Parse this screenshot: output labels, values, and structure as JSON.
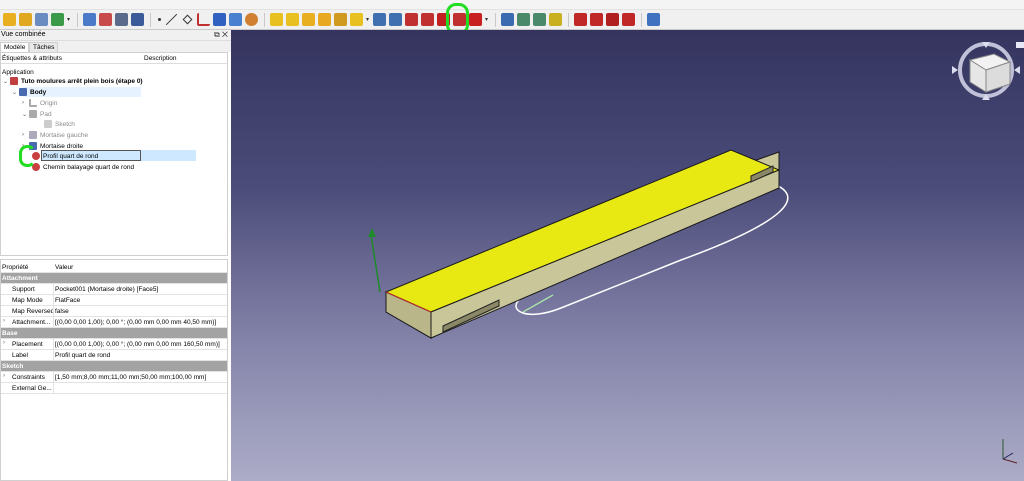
{
  "toolbar": {
    "icons": [
      "std-open-icon",
      "std-folder-icon",
      "std-save-icon",
      "std-export-icon",
      "macro-icon",
      "part-icon",
      "body-icon",
      "import-icon",
      "clone-icon",
      "point-icon",
      "line-icon",
      "plane-icon",
      "lcs-icon",
      "shapebinder-icon",
      "subshape-icon",
      "sketch-icon",
      "pad-icon",
      "revolve-icon",
      "loft-icon",
      "pipe-icon",
      "helix-icon",
      "add-box-icon",
      "pocket-icon",
      "hole-icon",
      "groove-icon",
      "subtractive-loft-icon",
      "subtractive-pipe-icon",
      "subtractive-helix-icon",
      "subtractive-box-icon",
      "mirrored-icon",
      "linear-pattern-icon",
      "polar-pattern-icon",
      "multitransform-icon",
      "fillet-icon",
      "chamfer-icon",
      "draft-icon",
      "thickness-icon",
      "boolean-icon"
    ]
  },
  "combo": {
    "title": "Vue combinée",
    "title_buttons": "⧉ ✕",
    "tabs": [
      "Modèle",
      "Tâches"
    ]
  },
  "tree": {
    "col_labels": "Étiquettes & attributs",
    "col_description": "Description",
    "root": "Application",
    "items": [
      {
        "label": "Tuto moulures arrêt plein bois (étape 0)",
        "icon": "document-icon"
      },
      {
        "label": "Body",
        "icon": "body-icon"
      },
      {
        "label": "Origin",
        "icon": "origin-icon"
      },
      {
        "label": "Pad",
        "icon": "pad-icon"
      },
      {
        "label": "Sketch",
        "icon": "sketch-icon"
      },
      {
        "label": "Mortaise gauche",
        "icon": "pocket-icon"
      },
      {
        "label": "Mortaise droite",
        "icon": "pocket-icon"
      },
      {
        "label": "Profil quart de rond",
        "icon": "sketch-icon"
      },
      {
        "label": "Chemin balayage quart de rond",
        "icon": "sketch-icon"
      }
    ]
  },
  "properties": {
    "head_property": "Propriété",
    "head_value": "Valeur",
    "groups": [
      {
        "name": "Attachment",
        "rows": [
          {
            "key": "Support",
            "value": "Pocket001 (Mortaise droite) [Face5]"
          },
          {
            "key": "Map Mode",
            "value": "FlatFace"
          },
          {
            "key": "Map Reversed",
            "value": "false"
          },
          {
            "key": "Attachment...",
            "value": "[(0,00 0,00 1,00); 0,00 °; (0,00 mm  0,00 mm  40,50 mm)]"
          }
        ]
      },
      {
        "name": "Base",
        "rows": [
          {
            "key": "Placement",
            "value": "[(0,00 0,00 1,00); 0,00 °; (0,00 mm  0,00 mm  160,50 mm)]"
          },
          {
            "key": "Label",
            "value": "Profil quart de rond"
          }
        ]
      },
      {
        "name": "Sketch",
        "rows": [
          {
            "key": "Constraints",
            "value": "[1,50 mm;8,00 mm;11,00 mm;50,00 mm;100,00 mm]"
          },
          {
            "key": "External Ge...",
            "value": ""
          }
        ]
      }
    ]
  },
  "colors": {
    "face_yellow": "#e8e813",
    "body_side": "#c9c79a",
    "viewport_top": "#34345f",
    "viewport_bottom": "#acacc8",
    "highlight_green": "#22dd22"
  }
}
